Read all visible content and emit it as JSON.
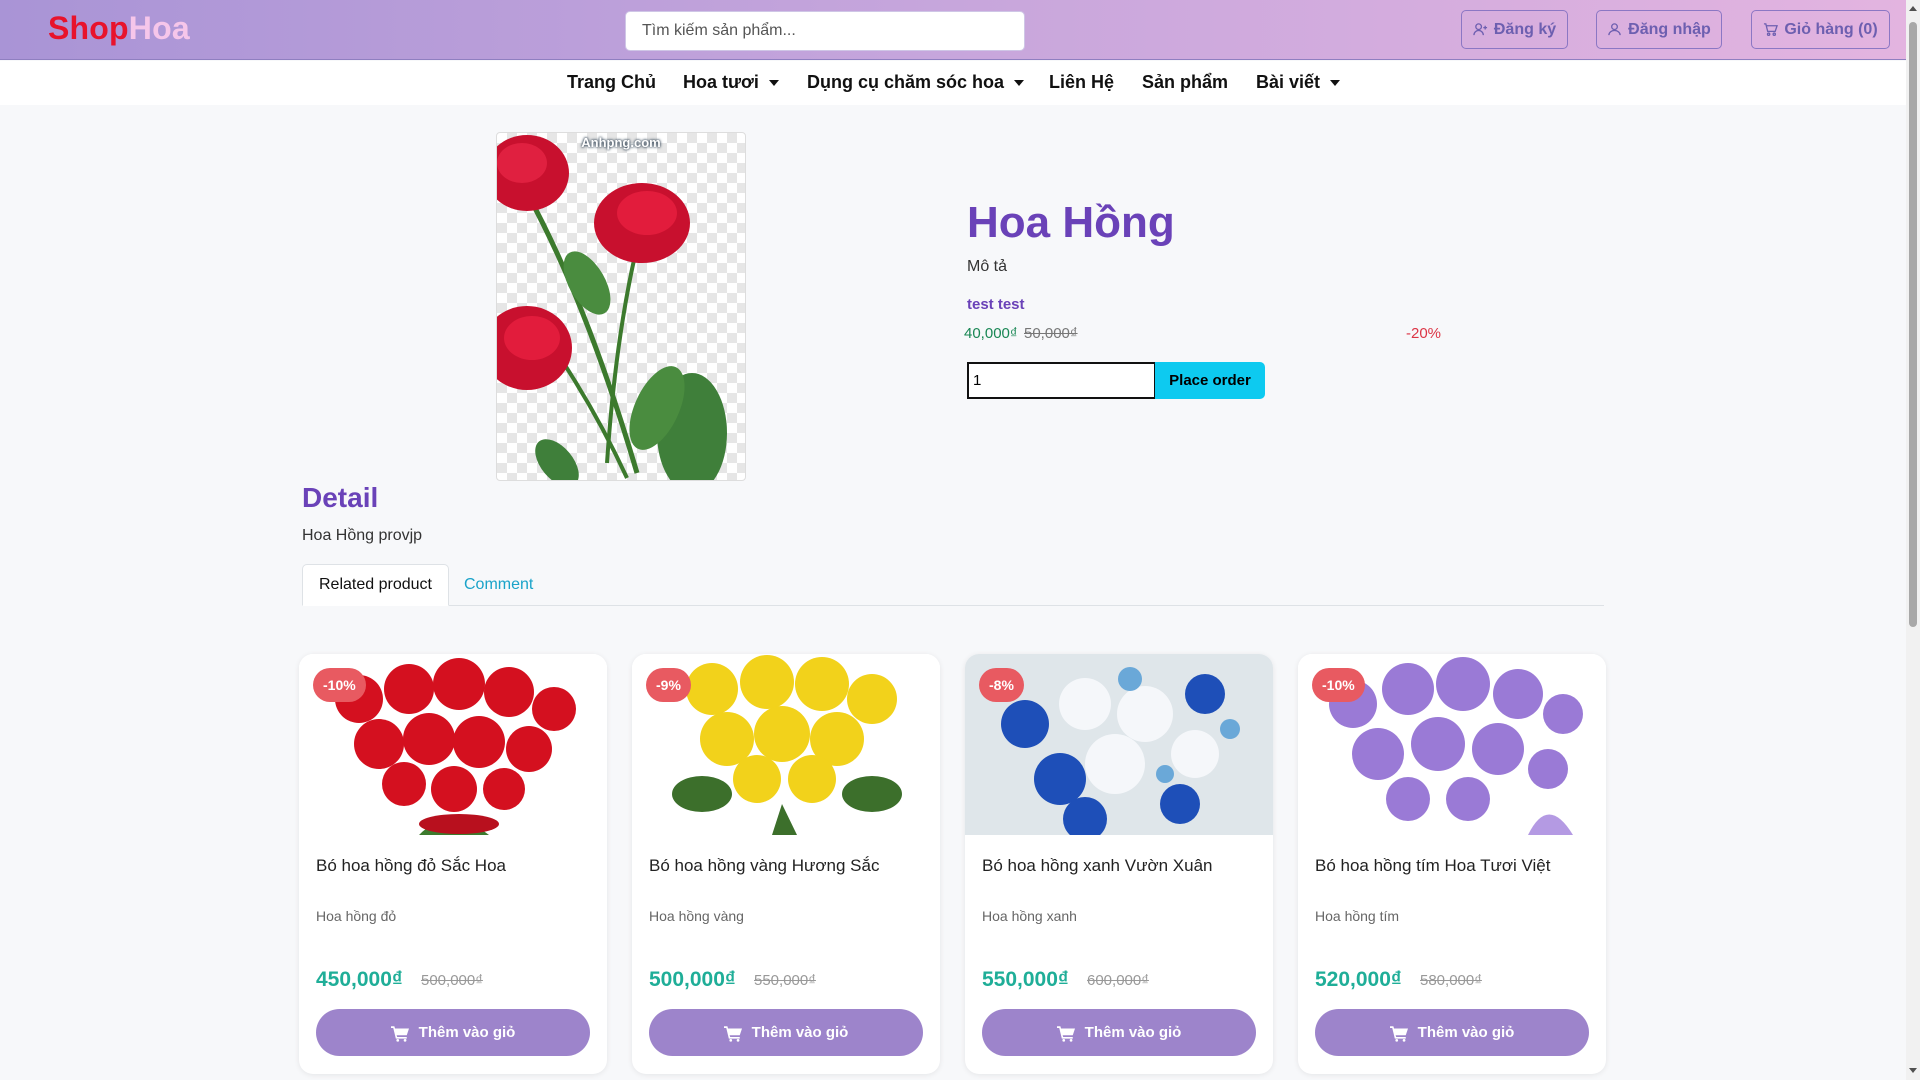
{
  "header": {
    "logo_part1": "Shop",
    "logo_part2": "Hoa",
    "search_placeholder": "Tìm kiếm sản phẩm...",
    "register_label": "Đăng ký",
    "login_label": "Đăng nhập",
    "cart_label": "Giỏ hàng (0)"
  },
  "nav": {
    "items": [
      {
        "label": "Trang Chủ",
        "dropdown": false
      },
      {
        "label": "Hoa tươi",
        "dropdown": true
      },
      {
        "label": "Dụng cụ chăm sóc hoa",
        "dropdown": true
      },
      {
        "label": "Liên Hệ",
        "dropdown": false
      },
      {
        "label": "Sản phẩm",
        "dropdown": false
      },
      {
        "label": "Bài viết",
        "dropdown": true
      }
    ]
  },
  "product": {
    "image_watermark": "Anhpng.com",
    "title": "Hoa Hồng",
    "description_label": "Mô tả",
    "description": "test test",
    "price": "40,000₫",
    "old_price": "50,000₫",
    "discount": "-20%",
    "quantity": "1",
    "order_button": "Place order"
  },
  "detail": {
    "heading": "Detail",
    "text": "Hoa Hồng provjp"
  },
  "tabs": [
    {
      "label": "Related product",
      "active": true
    },
    {
      "label": "Comment",
      "active": false
    }
  ],
  "related": [
    {
      "badge": "-10%",
      "name": "Bó hoa hồng đỏ Sắc Hoa",
      "category": "Hoa hồng đỏ",
      "price": "450,000₫",
      "old_price": "500,000₫",
      "button": "Thêm vào giỏ",
      "flower_color": "#d4101f",
      "bg_color": "#ffffff"
    },
    {
      "badge": "-9%",
      "name": "Bó hoa hồng vàng Hương Sắc",
      "category": "Hoa hồng vàng",
      "price": "500,000₫",
      "old_price": "550,000₫",
      "button": "Thêm vào giỏ",
      "flower_color": "#f2d21b",
      "bg_color": "#ffffff"
    },
    {
      "badge": "-8%",
      "name": "Bó hoa hồng xanh Vườn Xuân",
      "category": "Hoa hồng xanh",
      "price": "550,000₫",
      "old_price": "600,000₫",
      "button": "Thêm vào giỏ",
      "flower_color": "#1e4fb8",
      "bg_color": "#dfe6ea"
    },
    {
      "badge": "-10%",
      "name": "Bó hoa hồng tím Hoa Tươi Việt",
      "category": "Hoa hồng tím",
      "price": "520,000₫",
      "old_price": "580,000₫",
      "button": "Thêm vào giỏ",
      "flower_color": "#9a7ad6",
      "bg_color": "#ffffff"
    }
  ],
  "colors": {
    "accent": "#6a42b8",
    "price_green": "#1fae98",
    "discount_red": "#e85a61",
    "button_purple": "#9d84cb"
  }
}
